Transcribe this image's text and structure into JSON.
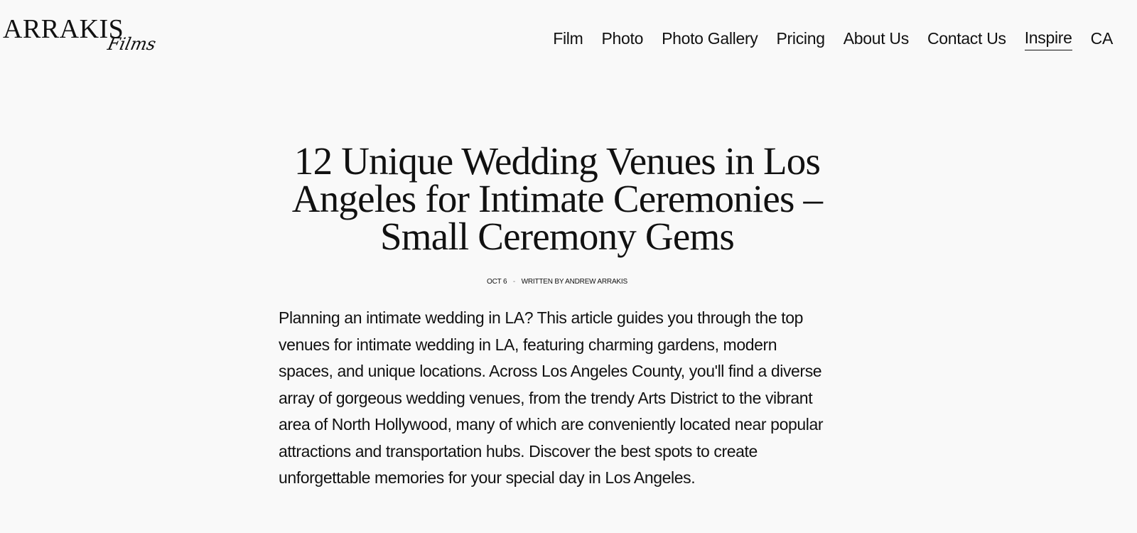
{
  "brand": {
    "wordmark": "ARRAKIS",
    "script": "Films"
  },
  "nav": {
    "items": [
      {
        "label": "Film",
        "active": false
      },
      {
        "label": "Photo",
        "active": false
      },
      {
        "label": "Photo Gallery",
        "active": false
      },
      {
        "label": "Pricing",
        "active": false
      },
      {
        "label": "About Us",
        "active": false
      },
      {
        "label": "Contact Us",
        "active": false
      },
      {
        "label": "Inspire",
        "active": true
      },
      {
        "label": "CA",
        "active": false
      }
    ]
  },
  "article": {
    "title": "12 Unique Wedding Venues in Los Angeles for Intimate Ceremonies – Small Ceremony Gems",
    "date": "OCT 6",
    "separator": "-",
    "byline": "WRITTEN BY ANDREW ARRAKIS",
    "intro": "Planning an intimate wedding in LA? This article guides you through the top venues for intimate wedding in LA, featuring charming gardens, modern spaces, and unique locations. Across Los Angeles County, you'll find a diverse array of gorgeous wedding venues, from the trendy Arts District to the vibrant area of North Hollywood, many of which are conveniently located near popular attractions and transportation hubs. Discover the best spots to create unforgettable memories for your special day in Los Angeles."
  }
}
